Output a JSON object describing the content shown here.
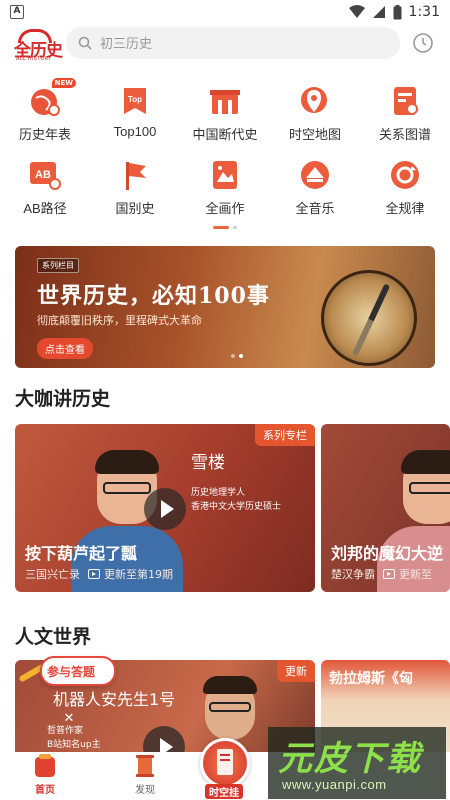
{
  "status_bar": {
    "time": "1:31"
  },
  "header": {
    "logo_text": "全历史",
    "logo_sub": "ALL HISTORY",
    "search_placeholder": "初三历史"
  },
  "grid": {
    "row1": [
      {
        "label": "历史年表",
        "icon": "world-timeline-icon",
        "badge": "NEW"
      },
      {
        "label": "Top100",
        "icon": "top100-icon"
      },
      {
        "label": "中国断代史",
        "icon": "chinese-dynasty-icon"
      },
      {
        "label": "时空地图",
        "icon": "spacetime-map-icon"
      },
      {
        "label": "关系图谱",
        "icon": "relation-graph-icon"
      }
    ],
    "row2": [
      {
        "label": "AB路径",
        "icon": "ab-path-icon"
      },
      {
        "label": "国别史",
        "icon": "country-history-icon"
      },
      {
        "label": "全画作",
        "icon": "paintings-icon"
      },
      {
        "label": "全音乐",
        "icon": "music-icon"
      },
      {
        "label": "全规律",
        "icon": "patterns-icon"
      }
    ]
  },
  "banner": {
    "tag": "系列栏目",
    "title": "世界历史，必知100事",
    "subtitle": "彻底颠覆旧秩序，里程碑式大革命",
    "cta": "点击查看"
  },
  "section1": {
    "title": "大咖讲历史",
    "cards": [
      {
        "tag": "系列专栏",
        "speaker": "雪楼",
        "speaker_desc": "历史地理学人\n香港中文大学历史硕士",
        "title": "按下葫芦起了瓢",
        "series": "三国兴亡录",
        "update": "更新至第19期"
      },
      {
        "title": "刘邦的魔幻大逆",
        "series": "楚汉争霸",
        "update": "更新至"
      }
    ]
  },
  "section2": {
    "title": "人文世界",
    "cards": [
      {
        "tag": "更新",
        "title": "机器人安先生1号",
        "desc": "哲普作家\nB站知名up主"
      },
      {
        "title": "勃拉姆斯《匈"
      }
    ]
  },
  "quiz": {
    "label": "参与答题"
  },
  "bottom_nav": [
    {
      "label": "首页",
      "active": true
    },
    {
      "label": "发现",
      "active": false
    },
    {
      "label": "时空挂",
      "active": false
    }
  ],
  "watermark": {
    "title": "元皮下载",
    "url": "www.yuanpi.com"
  },
  "colors": {
    "accent": "#d7362b",
    "brand_orange": "#e86a3c"
  }
}
